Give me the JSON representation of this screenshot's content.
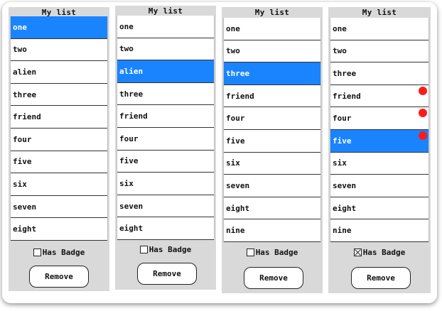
{
  "panels": [
    {
      "title": "My list",
      "items": [
        {
          "label": "one",
          "selected": true,
          "badge": false
        },
        {
          "label": "two",
          "selected": false,
          "badge": false
        },
        {
          "label": "alien",
          "selected": false,
          "badge": false
        },
        {
          "label": "three",
          "selected": false,
          "badge": false
        },
        {
          "label": "friend",
          "selected": false,
          "badge": false
        },
        {
          "label": "four",
          "selected": false,
          "badge": false
        },
        {
          "label": "five",
          "selected": false,
          "badge": false
        },
        {
          "label": "six",
          "selected": false,
          "badge": false
        },
        {
          "label": "seven",
          "selected": false,
          "badge": false
        },
        {
          "label": "eight",
          "selected": false,
          "badge": false
        }
      ],
      "has_badge_label": "Has Badge",
      "has_badge_checked": false,
      "remove_label": "Remove"
    },
    {
      "title": "My list",
      "items": [
        {
          "label": "one",
          "selected": false,
          "badge": false
        },
        {
          "label": "two",
          "selected": false,
          "badge": false
        },
        {
          "label": "alien",
          "selected": true,
          "badge": false
        },
        {
          "label": "three",
          "selected": false,
          "badge": false
        },
        {
          "label": "friend",
          "selected": false,
          "badge": false
        },
        {
          "label": "four",
          "selected": false,
          "badge": false
        },
        {
          "label": "five",
          "selected": false,
          "badge": false
        },
        {
          "label": "six",
          "selected": false,
          "badge": false
        },
        {
          "label": "seven",
          "selected": false,
          "badge": false
        },
        {
          "label": "eight",
          "selected": false,
          "badge": false
        }
      ],
      "has_badge_label": "Has Badge",
      "has_badge_checked": false,
      "remove_label": "Remove"
    },
    {
      "title": "My list",
      "items": [
        {
          "label": "one",
          "selected": false,
          "badge": false
        },
        {
          "label": "two",
          "selected": false,
          "badge": false
        },
        {
          "label": "three",
          "selected": true,
          "badge": false
        },
        {
          "label": "friend",
          "selected": false,
          "badge": false
        },
        {
          "label": "four",
          "selected": false,
          "badge": false
        },
        {
          "label": "five",
          "selected": false,
          "badge": false
        },
        {
          "label": "six",
          "selected": false,
          "badge": false
        },
        {
          "label": "seven",
          "selected": false,
          "badge": false
        },
        {
          "label": "eight",
          "selected": false,
          "badge": false
        },
        {
          "label": "nine",
          "selected": false,
          "badge": false
        }
      ],
      "has_badge_label": "Has Badge",
      "has_badge_checked": false,
      "remove_label": "Remove"
    },
    {
      "title": "My list",
      "items": [
        {
          "label": "one",
          "selected": false,
          "badge": false
        },
        {
          "label": "two",
          "selected": false,
          "badge": false
        },
        {
          "label": "three",
          "selected": false,
          "badge": false
        },
        {
          "label": "friend",
          "selected": false,
          "badge": true
        },
        {
          "label": "four",
          "selected": false,
          "badge": true
        },
        {
          "label": "five",
          "selected": true,
          "badge": true
        },
        {
          "label": "six",
          "selected": false,
          "badge": false
        },
        {
          "label": "seven",
          "selected": false,
          "badge": false
        },
        {
          "label": "eight",
          "selected": false,
          "badge": false
        },
        {
          "label": "nine",
          "selected": false,
          "badge": false
        }
      ],
      "has_badge_label": "Has Badge",
      "has_badge_checked": true,
      "remove_label": "Remove"
    }
  ],
  "colors": {
    "selection": "#1a84ff",
    "badge": "#ff1a1a",
    "panel_background": "#d9d9d9"
  },
  "icons": {
    "badge": "red-dot-badge-icon",
    "checkbox": "checkbox-icon"
  }
}
